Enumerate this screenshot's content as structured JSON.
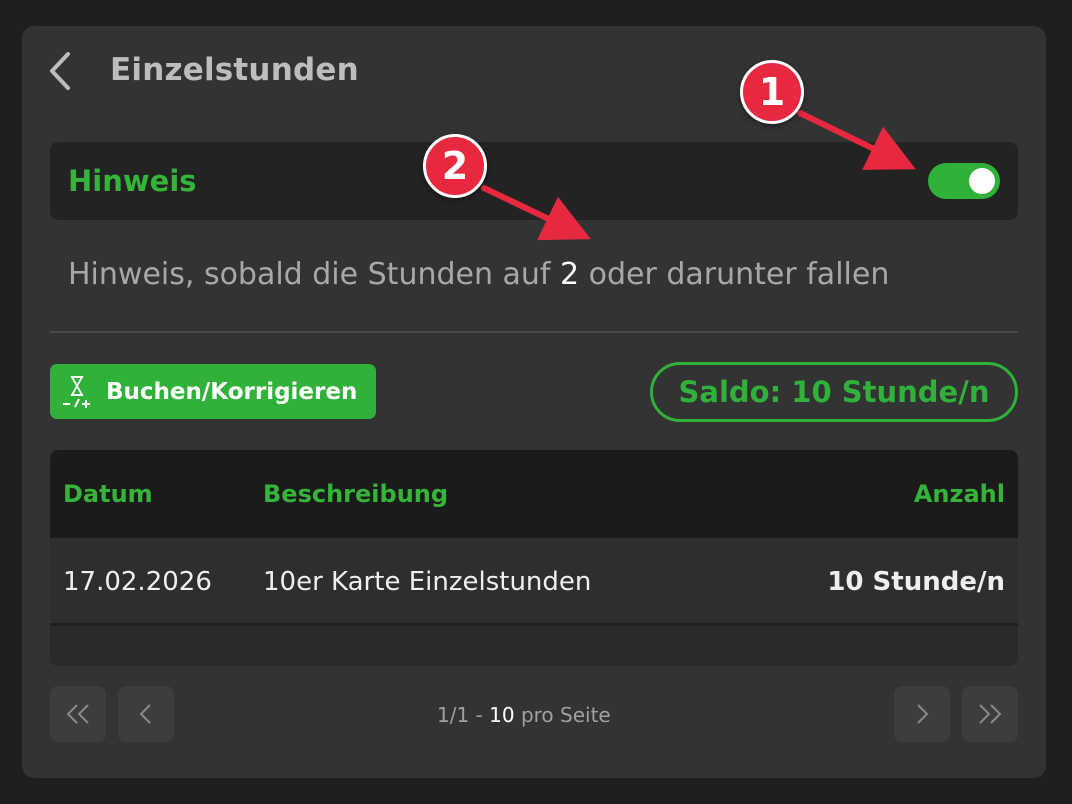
{
  "header": {
    "title": "Einzelstunden"
  },
  "hinweis": {
    "label": "Hinweis",
    "toggle_on": true,
    "text_before": "Hinweis, sobald die Stunden auf ",
    "threshold": "2",
    "text_after": " oder darunter fallen"
  },
  "actions": {
    "book_label": "Buchen/Korrigieren",
    "saldo_label": "Saldo: 10 Stunde/n"
  },
  "table": {
    "columns": [
      "Datum",
      "Beschreibung",
      "Anzahl"
    ],
    "rows": [
      {
        "datum": "17.02.2026",
        "beschreibung": "10er Karte Einzelstunden",
        "anzahl": "10 Stunde/n"
      }
    ]
  },
  "pagination": {
    "pages": "1/1 -",
    "per_page": "10",
    "per_page_label": "pro Seite"
  },
  "annotations": {
    "badge_1": "1",
    "badge_2": "2"
  },
  "colors": {
    "accent_green": "#2fb13a",
    "annotation_red": "#e8283f"
  }
}
